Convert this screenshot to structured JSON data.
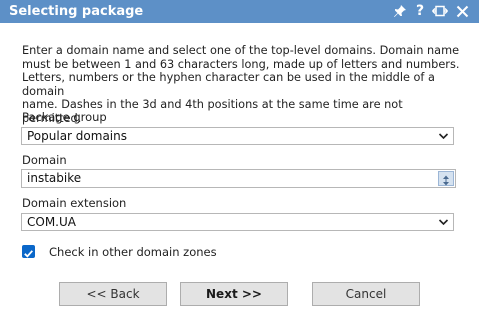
{
  "window": {
    "title": "Selecting package",
    "controls": [
      {
        "icon": "pin-icon",
        "label": "Pin"
      },
      {
        "icon": "help-icon",
        "label": "?"
      },
      {
        "icon": "maximize-icon",
        "label": "Maximize"
      },
      {
        "icon": "close-icon",
        "label": "Close"
      }
    ]
  },
  "description": "Enter a domain name and select one of the top-level domains. Domain name\nmust be between 1 and 63 characters long, made up of letters and numbers.\nLetters, numbers or the hyphen character can be used in the middle of a domain\nname. Dashes in the 3d and 4th positions at the same time are not permitted.",
  "package_group": {
    "label": "Package group",
    "selected": "Popular domains"
  },
  "domain": {
    "label": "Domain",
    "value": "instabike"
  },
  "domain_extension": {
    "label": "Domain extension",
    "selected": "COM.UA"
  },
  "other_zones": {
    "label": "Check in other domain zones",
    "checked": true
  },
  "buttons": {
    "back": "<< Back",
    "next": "Next >>",
    "cancel": "Cancel"
  },
  "colors": {
    "titlebar": "#5d90c7",
    "checkbox": "#0a67c9",
    "button_bg": "#e3e3e3"
  }
}
